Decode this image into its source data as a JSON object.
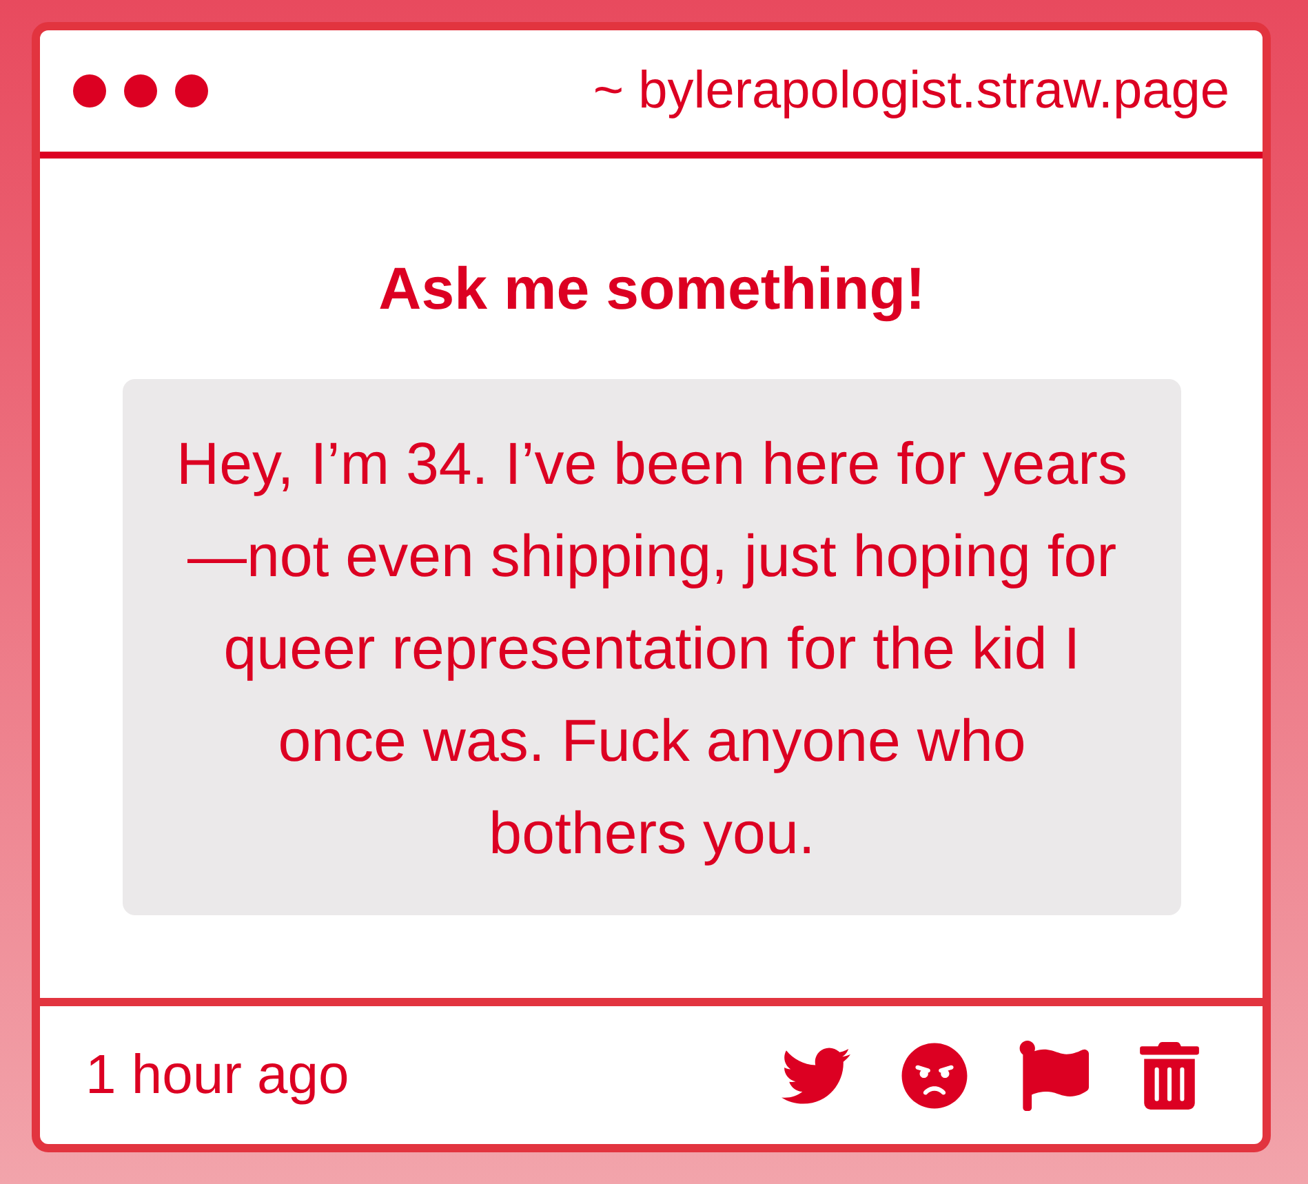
{
  "header": {
    "address": "~ bylerapologist.straw.page"
  },
  "title": "Ask me something!",
  "message": {
    "text": "Hey, I’m 34. I’ve been here for years—not even shipping, just hoping for queer representation for the kid I once was. Fuck anyone who bothers you."
  },
  "footer": {
    "time": "1 hour ago"
  }
}
